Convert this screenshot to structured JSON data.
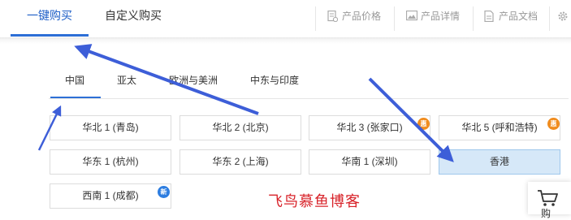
{
  "main_tabs": [
    {
      "label": "一键购买",
      "active": true
    },
    {
      "label": "自定义购买",
      "active": false
    }
  ],
  "toolbar": [
    {
      "label": "产品价格",
      "icon": "price-doc-icon"
    },
    {
      "label": "产品详情",
      "icon": "detail-image-icon"
    },
    {
      "label": "产品文档",
      "icon": "document-icon"
    },
    {
      "label": "",
      "icon": "gear-icon"
    }
  ],
  "region_tabs": [
    {
      "label": "中国",
      "active": true
    },
    {
      "label": "亚太",
      "active": false
    },
    {
      "label": "欧洲与美洲",
      "active": false
    },
    {
      "label": "中东与印度",
      "active": false
    }
  ],
  "zones": [
    {
      "label": "华北 1 (青岛)"
    },
    {
      "label": "华北 2 (北京)"
    },
    {
      "label": "华北 3 (张家口)",
      "badge": "惠"
    },
    {
      "label": "华北 5 (呼和浩特)",
      "badge": "惠"
    },
    {
      "label": "华东 1 (杭州)"
    },
    {
      "label": "华东 2 (上海)"
    },
    {
      "label": "华南 1 (深圳)"
    },
    {
      "label": "香港",
      "selected": true
    },
    {
      "label": "西南 1 (成都)",
      "badge": "新"
    }
  ],
  "watermark": "飞鸟慕鱼博客",
  "cart": {
    "label": "购",
    "icon": "cart-icon"
  },
  "colors": {
    "accent": "#2d6fd6",
    "annotation_arrow": "#3d5ed8",
    "badge_discount": "#f08c1e",
    "badge_new": "#2d7de0",
    "selected_bg": "#d6e8f8",
    "watermark": "#d8232a"
  }
}
